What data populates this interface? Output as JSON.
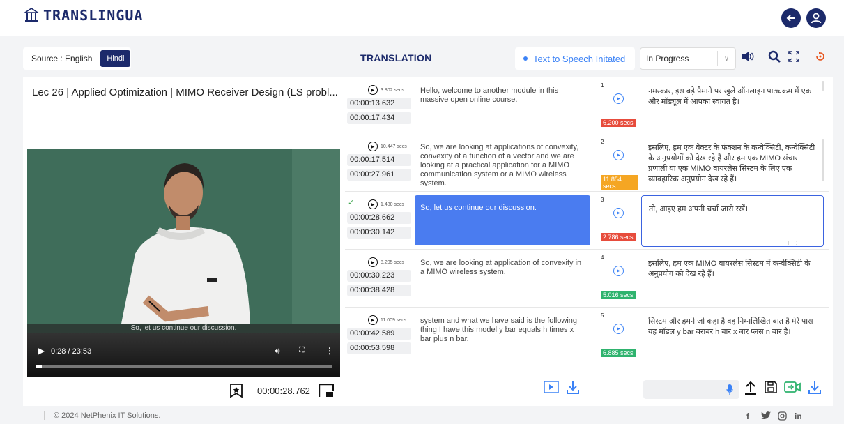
{
  "header": {
    "logo_text": "TRANSLINGUA"
  },
  "topbar": {
    "source_label": "Source : English",
    "target_lang": "Hindi",
    "title": "TRANSLATION",
    "tts_status": "Text to Speech Initated",
    "status_selected": "In Progress"
  },
  "video": {
    "title": "Lec 26 | Applied Optimization | MIMO Receiver Design (LS probl...",
    "subtitle": "So, let us continue our discussion.",
    "time_display": "0:28 / 23:53",
    "progress_fraction": 0.02,
    "current_timestamp": "00:00:28.762"
  },
  "rows": [
    {
      "duration": "3.802 secs",
      "start": "00:00:13.632",
      "end": "00:00:17.434",
      "source": "Hello, welcome to another module in this massive open online course.",
      "num": "1",
      "badge": "6.200 secs",
      "badge_color": "#e74c3c",
      "target": "नमस्कार, इस बड़े पैमाने पर खुले ऑनलाइन पाठ्यक्रम में एक और मॉड्यूल में आपका स्वागत है।"
    },
    {
      "duration": "10.447 secs",
      "start": "00:00:17.514",
      "end": "00:00:27.961",
      "source": "So, we are looking at applications of convexity, convexity of a function of a vector and we are looking at a practical application for a MIMO communication system or a MIMO wireless system.",
      "num": "2",
      "badge": "11.854 secs",
      "badge_color": "#f5a623",
      "target": "इसलिए, हम एक वेक्टर के फंक्शन के कन्वेक्सिटी, कन्वेक्सिटी के अनुप्रयोगों को देख रहे हैं और हम एक MIMO संचार प्रणाली या एक MIMO वायरलेस सिस्टम के लिए एक व्यावहारिक अनुप्रयोग देख रहे हैं।"
    },
    {
      "duration": "1.480 secs",
      "start": "00:00:28.662",
      "end": "00:00:30.142",
      "source": "So, let us continue our discussion.",
      "num": "3",
      "badge": "2.786 secs",
      "badge_color": "#e74c3c",
      "target": "तो, आइए हम अपनी चर्चा जारी रखें।"
    },
    {
      "duration": "8.205 secs",
      "start": "00:00:30.223",
      "end": "00:00:38.428",
      "source": "So, we are looking at application of convexity in a MIMO wireless system.",
      "num": "4",
      "badge": "5.016 secs",
      "badge_color": "#2fb36e",
      "target": "इसलिए, हम एक MIMO वायरलेस सिस्टम में कन्वेक्सिटी के अनुप्रयोग को देख रहे हैं।"
    },
    {
      "duration": "11.009 secs",
      "start": "00:00:42.589",
      "end": "00:00:53.598",
      "source": "system and what we have said is the following thing I have this model y bar equals h times x bar plus n bar.",
      "num": "5",
      "badge": "6.885 secs",
      "badge_color": "#2fb36e",
      "target": "सिस्टम और हमने जो कहा है वह निम्नलिखित बात है मेरे पास यह मॉडल y bar बराबर h बार x बार प्लस n बार है।"
    },
    {
      "num": "-"
    }
  ],
  "footer": {
    "copyright": "© 2024 NetPhenix IT Solutions.",
    "social": [
      "f-icon",
      "twitter-icon",
      "instagram-icon",
      "linkedin-icon"
    ],
    "linkedin_text": "in"
  },
  "colors": {
    "brand": "#1c2a6b",
    "accent": "#3b82f6",
    "active_row": "#4a7cf0"
  }
}
